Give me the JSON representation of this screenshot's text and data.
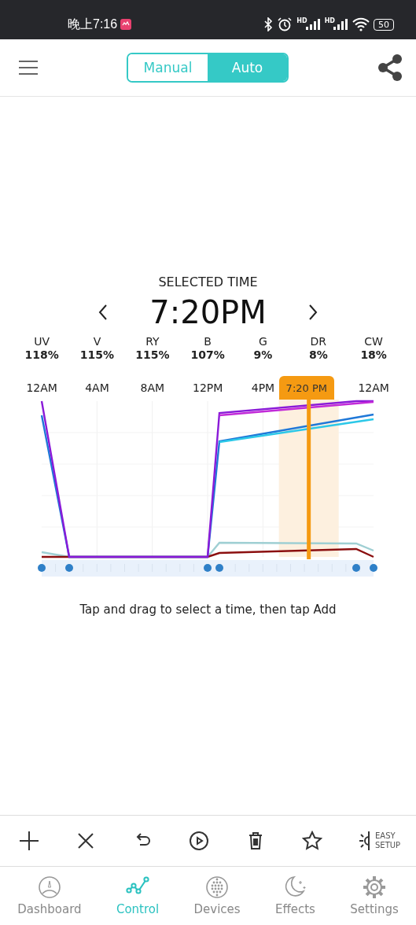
{
  "status_bar": {
    "time": "晚上7:16",
    "signals": [
      {
        "label": "HD"
      },
      {
        "label": "HD"
      }
    ],
    "battery": "50"
  },
  "header": {
    "modes": [
      {
        "label": "Manual",
        "selected": false
      },
      {
        "label": "Auto",
        "selected": true
      }
    ]
  },
  "selected_time": {
    "heading": "SELECTED TIME",
    "time": "7:20PM"
  },
  "channels": [
    {
      "name": "UV",
      "value": "118%"
    },
    {
      "name": "V",
      "value": "115%"
    },
    {
      "name": "RY",
      "value": "115%"
    },
    {
      "name": "B",
      "value": "107%"
    },
    {
      "name": "G",
      "value": "9%"
    },
    {
      "name": "DR",
      "value": "8%"
    },
    {
      "name": "CW",
      "value": "18%"
    }
  ],
  "timeline": {
    "axis_labels": [
      {
        "label": "12AM",
        "selected": false
      },
      {
        "label": "4AM",
        "selected": false
      },
      {
        "label": "8AM",
        "selected": false
      },
      {
        "label": "12PM",
        "selected": false
      },
      {
        "label": "4PM",
        "selected": false
      },
      {
        "label": "7:20 PM",
        "selected": true
      },
      {
        "label": "12AM",
        "selected": false
      }
    ]
  },
  "hint": "Tap and drag to select a time, then tap Add",
  "toolbar": [
    {
      "kind": "add"
    },
    {
      "kind": "remove"
    },
    {
      "kind": "undo"
    },
    {
      "kind": "play"
    },
    {
      "kind": "delete"
    },
    {
      "kind": "favorite"
    },
    {
      "kind": "easy_setup",
      "label": "EASY SETUP"
    }
  ],
  "nav": [
    {
      "kind": "dashboard",
      "label": "Dashboard",
      "selected": false
    },
    {
      "kind": "control",
      "label": "Control",
      "selected": true
    },
    {
      "kind": "devices",
      "label": "Devices",
      "selected": false
    },
    {
      "kind": "effects",
      "label": "Effects",
      "selected": false
    },
    {
      "kind": "settings",
      "label": "Settings",
      "selected": false
    }
  ]
}
